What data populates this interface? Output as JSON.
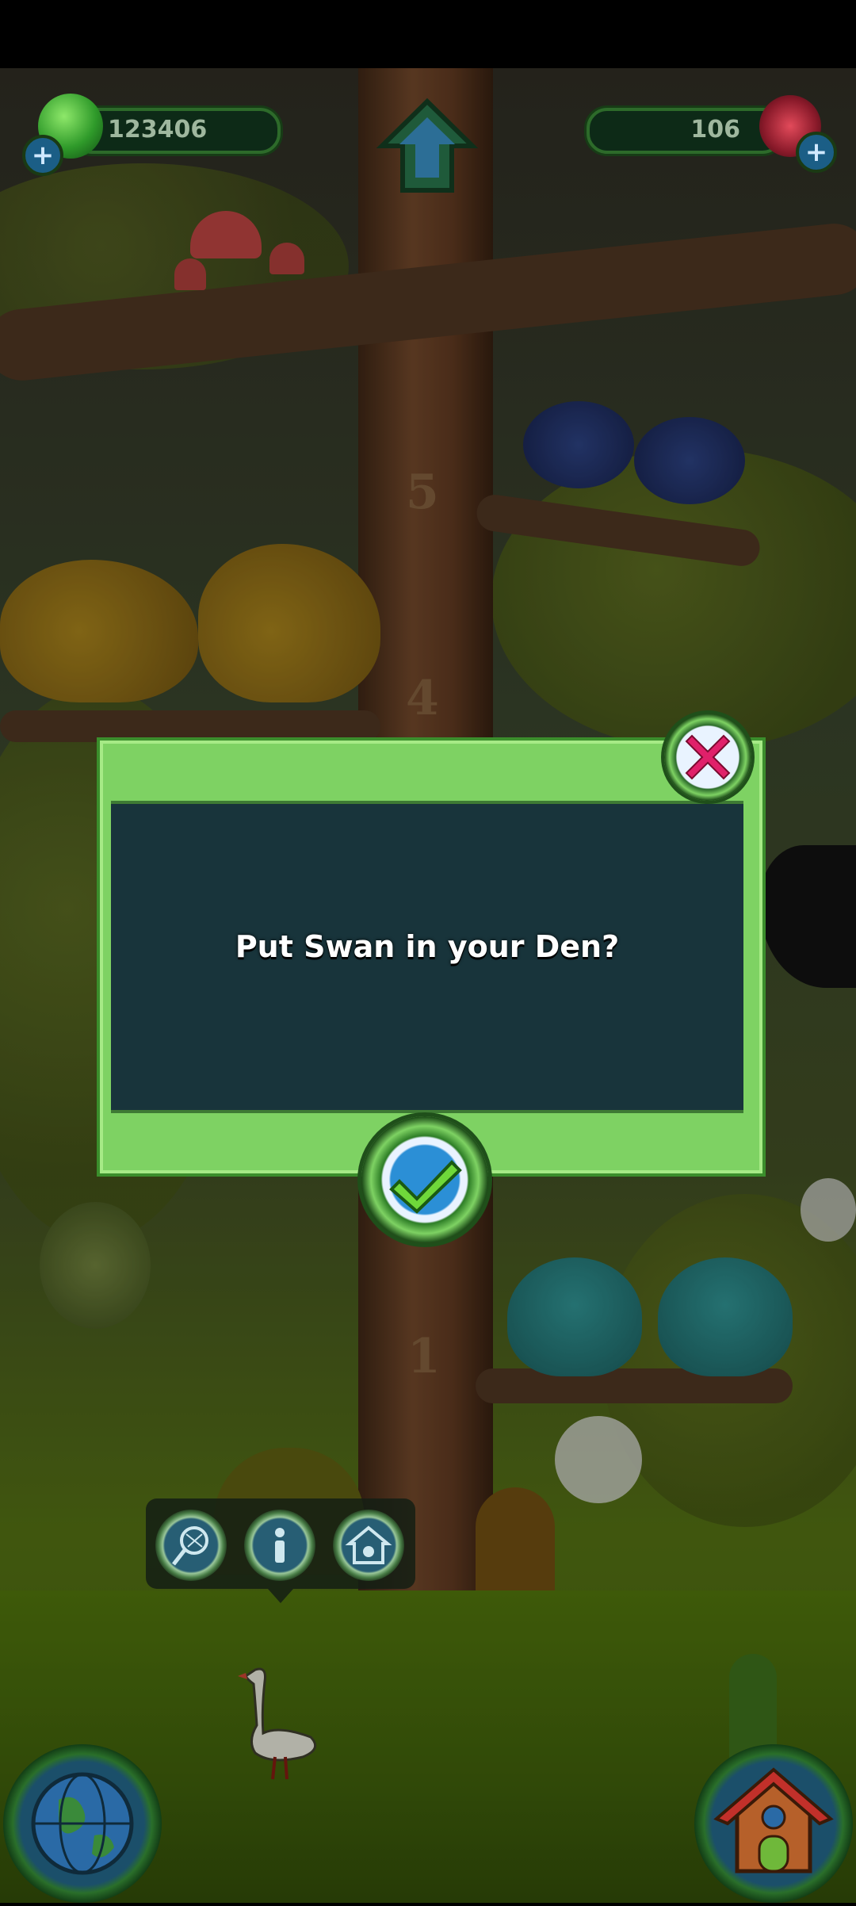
{
  "hud": {
    "currency_green": "123406",
    "currency_gems": "106"
  },
  "dialog": {
    "message": "Put Swan in your Den?"
  },
  "scene": {
    "tree_numbers": [
      "5",
      "4",
      "1"
    ]
  },
  "icons": {
    "green_orb": "green-gem-icon",
    "red_gem": "red-gem-icon",
    "home": "home-arrow-icon",
    "close": "close-x-icon",
    "confirm": "checkmark-icon",
    "net": "net-icon",
    "info": "info-icon",
    "den": "den-icon",
    "globe": "globe-icon",
    "house": "house-icon"
  },
  "colors": {
    "dialog_green": "#7ed263",
    "dialog_panel": "#18343b",
    "close_accent": "#e0206a",
    "confirm_accent": "#2b8fd6"
  }
}
